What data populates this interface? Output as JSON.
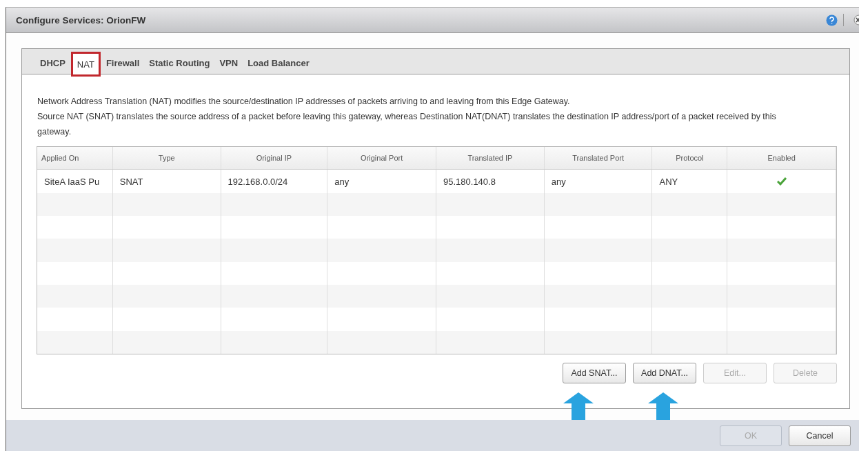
{
  "window": {
    "title": "Configure Services: OrionFW"
  },
  "tabs": [
    {
      "label": "DHCP",
      "selected": false
    },
    {
      "label": "NAT",
      "selected": true
    },
    {
      "label": "Firewall",
      "selected": false
    },
    {
      "label": "Static Routing",
      "selected": false
    },
    {
      "label": "VPN",
      "selected": false
    },
    {
      "label": "Load Balancer",
      "selected": false
    }
  ],
  "description": [
    "Network Address Translation (NAT) modifies the source/destination IP addresses of packets arriving to and leaving from this Edge Gateway.",
    "Source NAT (SNAT) translates the source address of a packet before leaving this gateway, whereas Destination NAT(DNAT)  translates the destination IP address/port of a packet received by this gateway."
  ],
  "table": {
    "columns": [
      "Applied On",
      "Type",
      "Original IP",
      "Original Port",
      "Translated IP",
      "Translated Port",
      "Protocol",
      "Enabled"
    ],
    "rows": [
      {
        "cells": [
          "SiteA IaaS Pu",
          "SNAT",
          "192.168.0.0/24",
          "any",
          "95.180.140.8",
          "any",
          "ANY"
        ],
        "enabled": true
      }
    ]
  },
  "actions": [
    {
      "label": "Add SNAT...",
      "disabled": false,
      "arrow": true
    },
    {
      "label": "Add DNAT...",
      "disabled": false,
      "arrow": true
    },
    {
      "label": "Edit...",
      "disabled": true,
      "arrow": false
    },
    {
      "label": "Delete",
      "disabled": true,
      "arrow": false
    }
  ],
  "footer_buttons": [
    {
      "label": "OK",
      "disabled": true
    },
    {
      "label": "Cancel",
      "disabled": false
    }
  ]
}
